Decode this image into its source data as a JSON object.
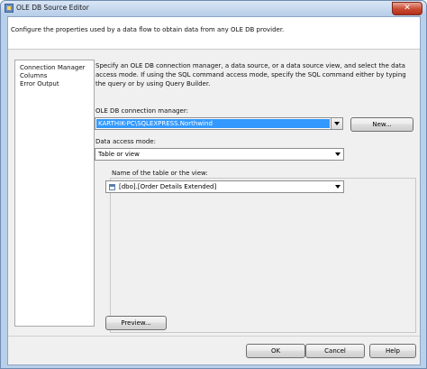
{
  "window": {
    "title": "OLE DB Source Editor",
    "close_label": "✕"
  },
  "header": {
    "text": "Configure the properties used by a data flow to obtain data from any OLE DB provider."
  },
  "nav": {
    "items": [
      {
        "label": "Connection Manager"
      },
      {
        "label": "Columns"
      },
      {
        "label": "Error Output"
      }
    ]
  },
  "main": {
    "description": "Specify an OLE DB connection manager, a data source, or a data source view, and select the data access mode. If using the SQL command access mode, specify the SQL command either by typing the query or by using Query Builder.",
    "connection_label": "OLE DB connection manager:",
    "connection_value": "KARTHIK-PC\\SQLEXPRESS.Northwind",
    "new_button": "New...",
    "access_mode_label": "Data access mode:",
    "access_mode_value": "Table or view",
    "table_label": "Name of the table or the view:",
    "table_value": "[dbo].[Order Details Extended]",
    "preview_button": "Preview..."
  },
  "footer": {
    "ok": "OK",
    "cancel": "Cancel",
    "help": "Help"
  }
}
